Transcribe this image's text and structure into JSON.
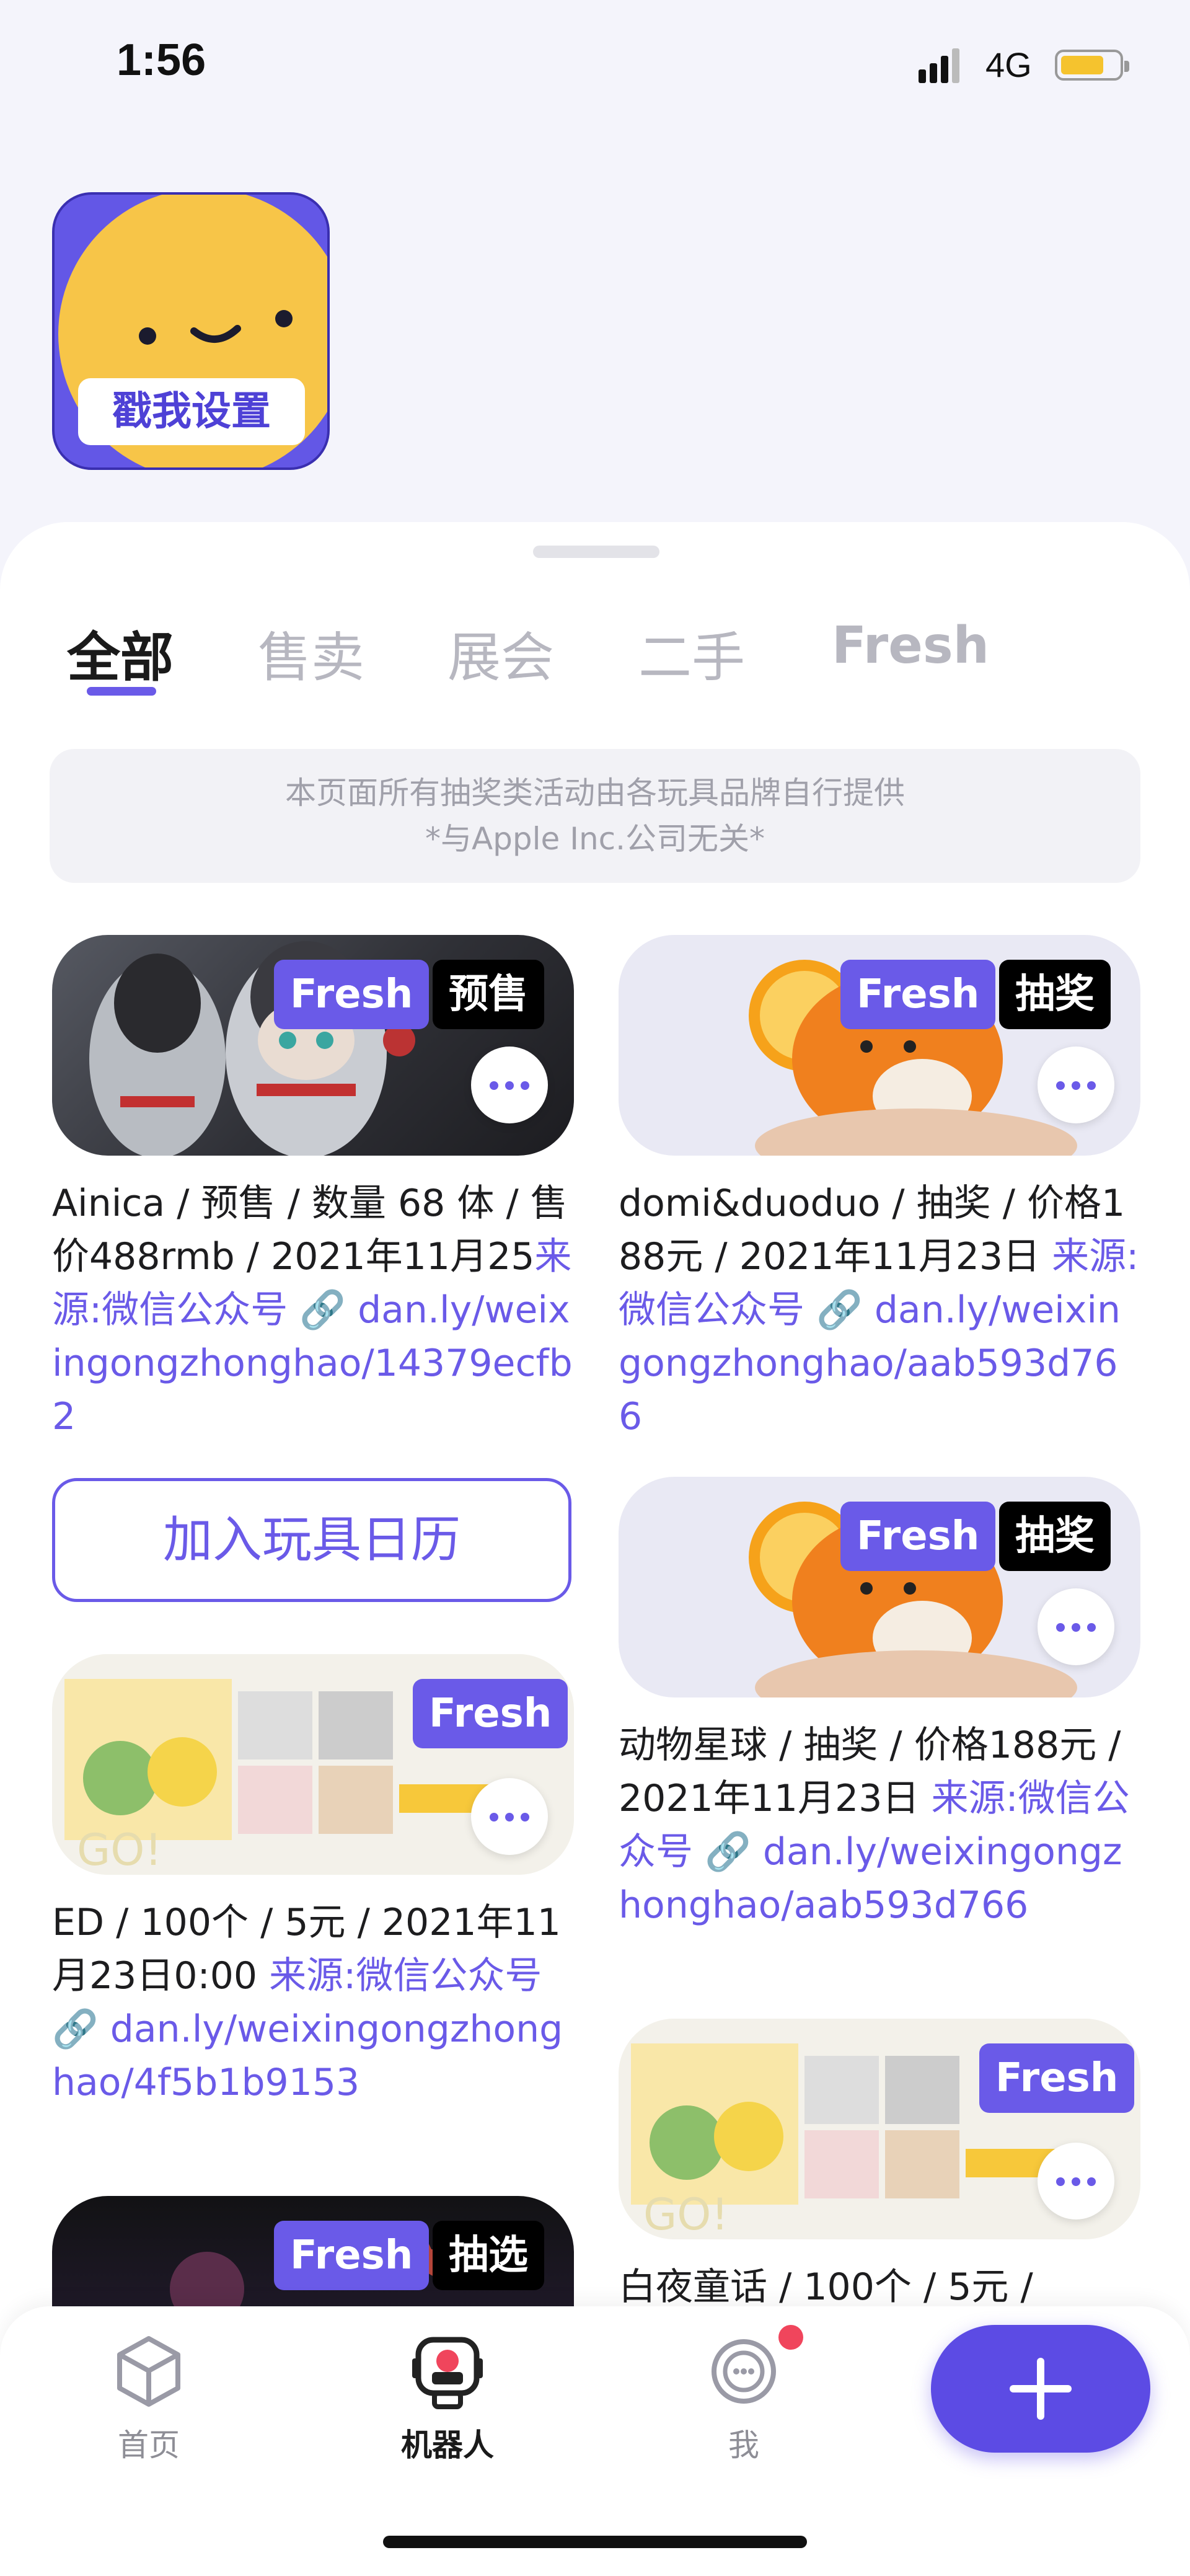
{
  "status_bar": {
    "time": "1:56",
    "network": "4G"
  },
  "setting_card": {
    "label": "戳我设置"
  },
  "tabs": [
    {
      "label": "全部",
      "active": true
    },
    {
      "label": "售卖"
    },
    {
      "label": "展会"
    },
    {
      "label": "二手"
    },
    {
      "label": "Fresh"
    }
  ],
  "notice": {
    "line1": "本页面所有抽奖类活动由各玩具品牌自行提供",
    "line2": "*与Apple Inc.公司无关*"
  },
  "cards": [
    {
      "fresh_badge": "Fresh",
      "type_badge": "预售",
      "text": "Ainica / 预售 / 数量 68 体 / 售价488rmb / 2021年11月25",
      "link_text": "来源:微信公众号 🔗 dan.ly/weixingongzhonghao/14379ecfb2"
    },
    {
      "fresh_badge": "Fresh",
      "type_badge": "抽奖",
      "text": "domi&duoduo / 抽奖 / 价格188元 / 2021年11月23日 ",
      "link_text": "来源:微信公众号 🔗 dan.ly/weixingongzhonghao/aab593d766"
    },
    {
      "fresh_badge": "Fresh",
      "type_badge": "抽奖",
      "text": "动物星球 / 抽奖 / 价格188元 / 2021年11月23日 ",
      "link_text": "来源:微信公众号 🔗 dan.ly/weixingongzhonghao/aab593d766"
    },
    {
      "fresh_badge": "Fresh",
      "text": "ED / 100个 / 5元 / 2021年11月23日0:00 ",
      "link_text": "来源:微信公众号 🔗 dan.ly/weixingongzhonghao/4f5b1b9153"
    },
    {
      "fresh_badge": "Fresh",
      "text": "白夜童话 / 100个 / 5元 / "
    },
    {
      "fresh_badge": "Fresh",
      "type_badge": "抽选"
    }
  ],
  "calendar_button": "加入玩具日历",
  "bottom_nav": [
    {
      "label": "首页",
      "icon": "home-cube-icon"
    },
    {
      "label": "机器人",
      "icon": "robot-icon",
      "active": true
    },
    {
      "label": "我",
      "icon": "profile-icon"
    }
  ],
  "add_button": {
    "icon": "plus-icon"
  },
  "colors": {
    "accent": "#6a5ae8",
    "badge_red": "#f0455c",
    "yellow": "#f7c548"
  }
}
